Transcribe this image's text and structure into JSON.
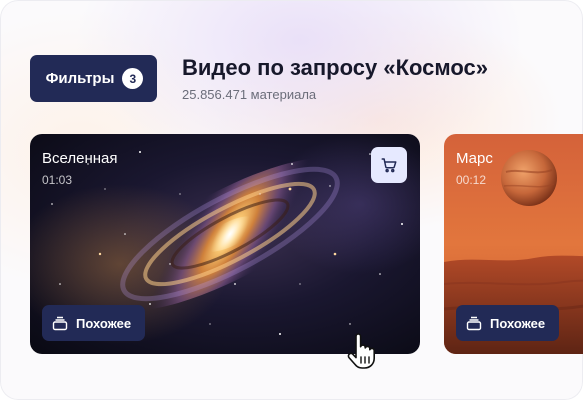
{
  "toolbar": {
    "filters_label": "Фильтры",
    "filters_count": "3"
  },
  "header": {
    "title": "Видео по запросу «Космос»",
    "subtitle": "25.856.471 материала"
  },
  "cards": [
    {
      "name": "Вселенная",
      "duration": "01:03",
      "similar_label": "Похожее",
      "thumbnail": "galaxy"
    },
    {
      "name": "Марс",
      "duration": "00:12",
      "similar_label": "Похожее",
      "thumbnail": "mars"
    }
  ],
  "icons": {
    "cart": "cart-icon",
    "similar": "stack-icon",
    "cursor": "hand-pointer-icon"
  },
  "colors": {
    "primary": "#222a56",
    "cart_bg": "#e6e9ff"
  }
}
